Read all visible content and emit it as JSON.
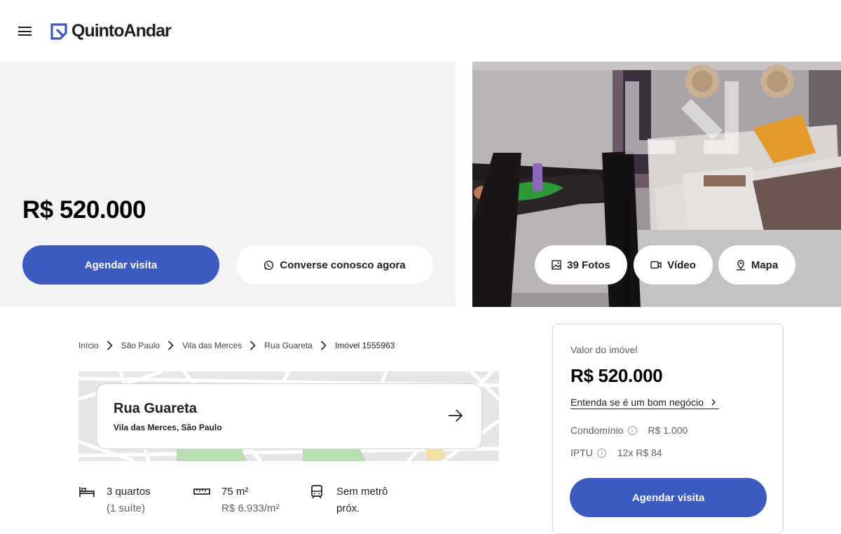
{
  "header": {
    "logo_text": "QuintoAndar",
    "menu_icon": "hamburger-menu-icon",
    "brand_color": "#3b5bc0"
  },
  "hero": {
    "price": "R$ 520.000",
    "schedule_button": "Agendar visita",
    "whatsapp_button": "Converse conosco agora",
    "photo_buttons": {
      "photos": "39 Fotos",
      "video": "Vídeo",
      "map": "Mapa"
    }
  },
  "breadcrumb": [
    "Início",
    "São Paulo",
    "Vila das Merces",
    "Rua Guareta",
    "Imóvel 1555963"
  ],
  "address": {
    "street": "Rua Guareta",
    "district": "Vila das Merces, São Paulo"
  },
  "features": {
    "bedrooms": {
      "main": "3 quartos",
      "sub": "(1 suíte)"
    },
    "area": {
      "main": "75 m²",
      "sub": "R$ 6.933/m²"
    },
    "metro": {
      "main": "Sem metrô",
      "sub": "próx."
    }
  },
  "side_card": {
    "label": "Valor do imóvel",
    "price": "R$ 520.000",
    "link": "Entenda se é um bom negócio",
    "condominio_label": "Condomínio",
    "condominio_value": "R$ 1.000",
    "iptu_label": "IPTU",
    "iptu_value": "12x R$ 84",
    "schedule_button": "Agendar visita"
  }
}
